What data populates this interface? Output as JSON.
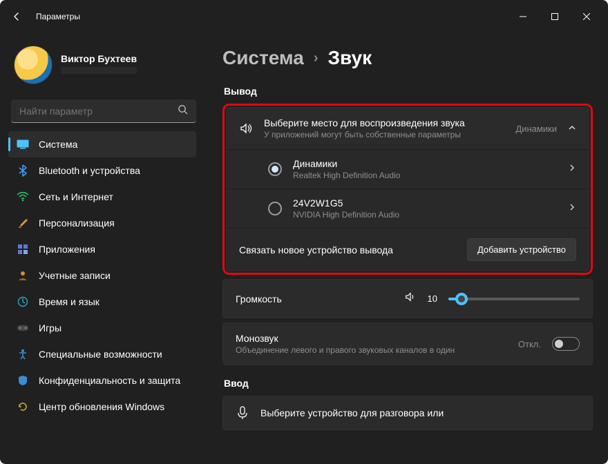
{
  "window_title": "Параметры",
  "user": {
    "name": "Виктор Бухтеев"
  },
  "search": {
    "placeholder": "Найти параметр"
  },
  "nav": [
    {
      "key": "system",
      "label": "Система",
      "active": true
    },
    {
      "key": "bluetooth",
      "label": "Bluetooth и устройства"
    },
    {
      "key": "network",
      "label": "Сеть и Интернет"
    },
    {
      "key": "personalization",
      "label": "Персонализация"
    },
    {
      "key": "apps",
      "label": "Приложения"
    },
    {
      "key": "accounts",
      "label": "Учетные записи"
    },
    {
      "key": "time",
      "label": "Время и язык"
    },
    {
      "key": "gaming",
      "label": "Игры"
    },
    {
      "key": "accessibility",
      "label": "Специальные возможности"
    },
    {
      "key": "privacy",
      "label": "Конфиденциальность и защита"
    },
    {
      "key": "update",
      "label": "Центр обновления Windows"
    }
  ],
  "breadcrumb": {
    "parent": "Система",
    "current": "Звук"
  },
  "output": {
    "section": "Вывод",
    "chooser": {
      "title": "Выберите место для воспроизведения звука",
      "subtitle": "У приложений могут быть собственные параметры",
      "value": "Динамики"
    },
    "devices": [
      {
        "name": "Динамики",
        "desc": "Realtek High Definition Audio",
        "selected": true
      },
      {
        "name": "24V2W1G5",
        "desc": "NVIDIA High Definition Audio",
        "selected": false
      }
    ],
    "pair": {
      "text": "Связать новое устройство вывода",
      "button": "Добавить устройство"
    }
  },
  "volume": {
    "label": "Громкость",
    "value": 10
  },
  "mono": {
    "title": "Монозвук",
    "subtitle": "Объединение левого и правого звуковых каналов в один",
    "state": "Откл."
  },
  "input": {
    "section": "Ввод",
    "chooser": {
      "title": "Выберите устройство для разговора или",
      "subtitle": ""
    }
  }
}
